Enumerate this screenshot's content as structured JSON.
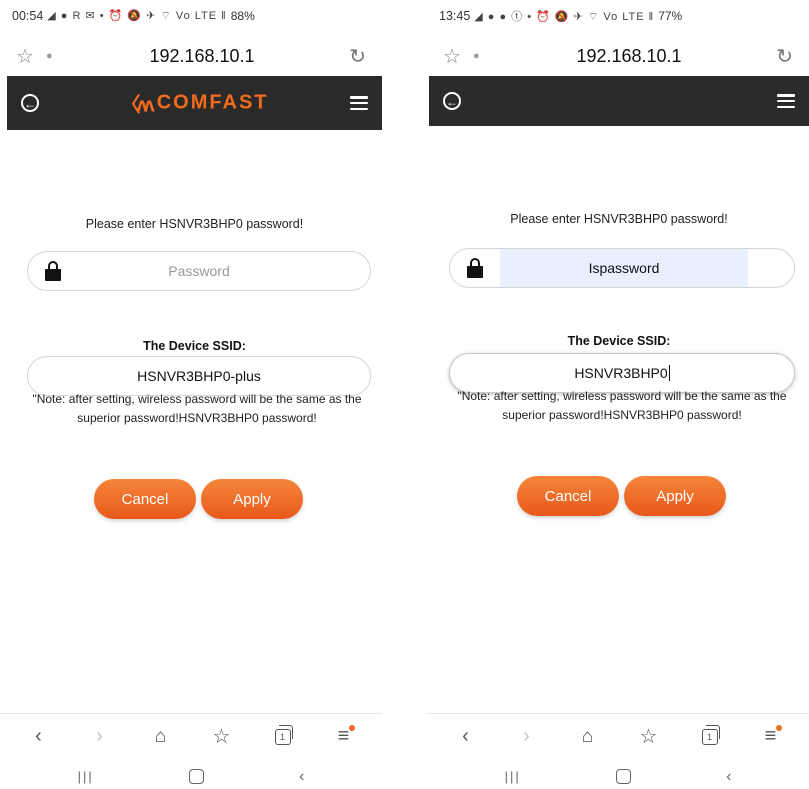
{
  "screens": [
    {
      "status": {
        "time": "00:54",
        "icons": "◢ ● R ✉ •   ⏰ 🔕 ✈ ⌔ Vo LTE ‖",
        "battery": "88%"
      },
      "browser": {
        "url": "192.168.10.1"
      },
      "header": {
        "logo_text": "COMFAST",
        "logo_mark": "〈ᴧᴧ"
      },
      "form": {
        "prompt": "Please enter HSNVR3BHP0 password!",
        "password_placeholder": "Password",
        "password_value": "",
        "ssid_label": "The Device SSID:",
        "ssid_value": "HSNVR3BHP0-plus",
        "note": "\"Note: after setting, wireless password will be the same as the superior password!HSNVR3BHP0 password!",
        "cancel_label": "Cancel",
        "apply_label": "Apply"
      }
    },
    {
      "status": {
        "time": "13:45",
        "icons": "◢ ● ● ⓣ •   ⏰ 🔕 ✈ ⌔ Vo LTE ‖",
        "battery": "77%"
      },
      "browser": {
        "url": "192.168.10.1"
      },
      "header": {
        "logo_text": "",
        "logo_mark": ""
      },
      "form": {
        "prompt": "Please enter HSNVR3BHP0 password!",
        "password_placeholder": "Password",
        "password_value": "Ispassword",
        "ssid_label": "The Device SSID:",
        "ssid_value": "HSNVR3BHP0",
        "note": "\"Note: after setting, wireless password will be the same as the superior password!HSNVR3BHP0 password!",
        "cancel_label": "Cancel",
        "apply_label": "Apply"
      }
    }
  ],
  "icons": {
    "star": "☆",
    "info": "●",
    "reload": "↻",
    "back": "←",
    "toolbar_back": "‹",
    "toolbar_forward": "›",
    "toolbar_home": "⌂",
    "toolbar_bookmark": "☆",
    "toolbar_menu": "≡",
    "tabs_count": "1",
    "nav_recent": "|||",
    "nav_back": "‹"
  },
  "colors": {
    "accent": "#f26b1d",
    "header_bg": "#2a2a2a",
    "autofill_bg": "#e8f0fe"
  }
}
